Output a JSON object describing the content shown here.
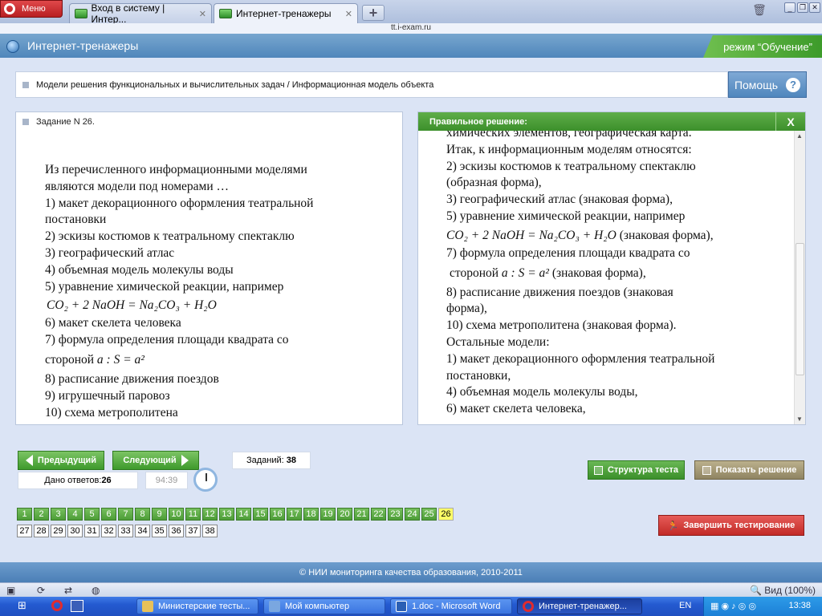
{
  "browser": {
    "menu_label": "Меню",
    "tabs": [
      {
        "title": "Вход в систему | Интер..."
      },
      {
        "title": "Интернет-тренажеры"
      }
    ],
    "url": "tt.i-exam.ru"
  },
  "app": {
    "title": "Интернет-тренажеры",
    "mode": "режим “Обучение”",
    "breadcrumb": "Модели решения функциональных и вычислительных задач / Информационная модель объекта",
    "help_label": "Помощь",
    "help_icon": "?"
  },
  "task": {
    "header": "Задание N 26.",
    "lines": [
      "Из перечисленного  информационными моделями",
      "являются модели под номерами …",
      "1) макет декорационного оформления театральной",
      "постановки",
      "2) эскизы костюмов к театральному спектаклю",
      "3) географический атлас",
      "4) объемная модель молекулы воды",
      "5) уравнение химической реакции, например"
    ],
    "equation": "CO₂ + 2 NaOH = Na₂CO₃ + H₂O",
    "lines2": [
      "6) макет скелета человека",
      "7) формула определения площади квадрата со"
    ],
    "side_line": "стороной",
    "side_math": "a :    S = a²",
    "lines3": [
      "8) расписание движения поездов",
      "9) игрушечный паровоз",
      "10) схема метрополитена"
    ]
  },
  "solution": {
    "header": "Правильное решение:",
    "close_label": "X",
    "lines": [
      "химических элементов, географическая карта.",
      "Итак, к информационным моделям относятся:",
      "2) эскизы костюмов к театральному спектаклю",
      "(образная форма),",
      "3) географический атлас (знаковая форма),",
      "5) уравнение химической реакции, например"
    ],
    "equation": "CO₂ + 2 NaOH = Na₂CO₃ + H₂O",
    "equation_suffix": "(знаковая форма),",
    "line7": "7) формула определения площади квадрата со",
    "side_line": "стороной",
    "side_math": "a :    S = a²",
    "side_suffix": "(знаковая форма),",
    "lines2": [
      "8) расписание движения поездов (знаковая",
      "форма),",
      "10) схема метрополитена (знаковая форма).",
      "Остальные модели:",
      "1) макет декорационного оформления театральной",
      "постановки,",
      "4) объемная модель молекулы воды,",
      "6) макет скелета человека,"
    ]
  },
  "nav": {
    "prev_label": "Предыдущий",
    "next_label": "Следующий",
    "answered_label": "Дано ответов:",
    "answered_value": "26",
    "timer": "94:39",
    "tasks_label": "Заданий:",
    "tasks_value": "38",
    "structure_label": "Структура теста",
    "show_solution_label": "Показать решение",
    "finish_label": "Завершить тестирование"
  },
  "pages": {
    "row1": [
      "1",
      "2",
      "3",
      "4",
      "5",
      "6",
      "7",
      "8",
      "9",
      "10",
      "11",
      "12",
      "13",
      "14",
      "15",
      "16",
      "17",
      "18",
      "19",
      "20",
      "21",
      "22",
      "23",
      "24",
      "25",
      "26"
    ],
    "row2": [
      "27",
      "28",
      "29",
      "30",
      "31",
      "32",
      "33",
      "34",
      "35",
      "36",
      "37",
      "38"
    ],
    "current": "26"
  },
  "footer": "© НИИ мониторинга качества образования, 2010-2011",
  "statusbar": {
    "zoom": "Вид (100%)"
  },
  "taskbar": {
    "items": [
      {
        "label": "Министерские тесты..."
      },
      {
        "label": "Мой компьютер"
      },
      {
        "label": "1.doc - Microsoft Word"
      },
      {
        "label": "Интернет-тренажер..."
      }
    ],
    "lang": "EN",
    "time": "13:38"
  },
  "colors": {
    "accent_green": "#3e9a2c",
    "header_blue": "#4f86bb",
    "finish_red": "#c22a27",
    "current_page": "#ffff66"
  }
}
